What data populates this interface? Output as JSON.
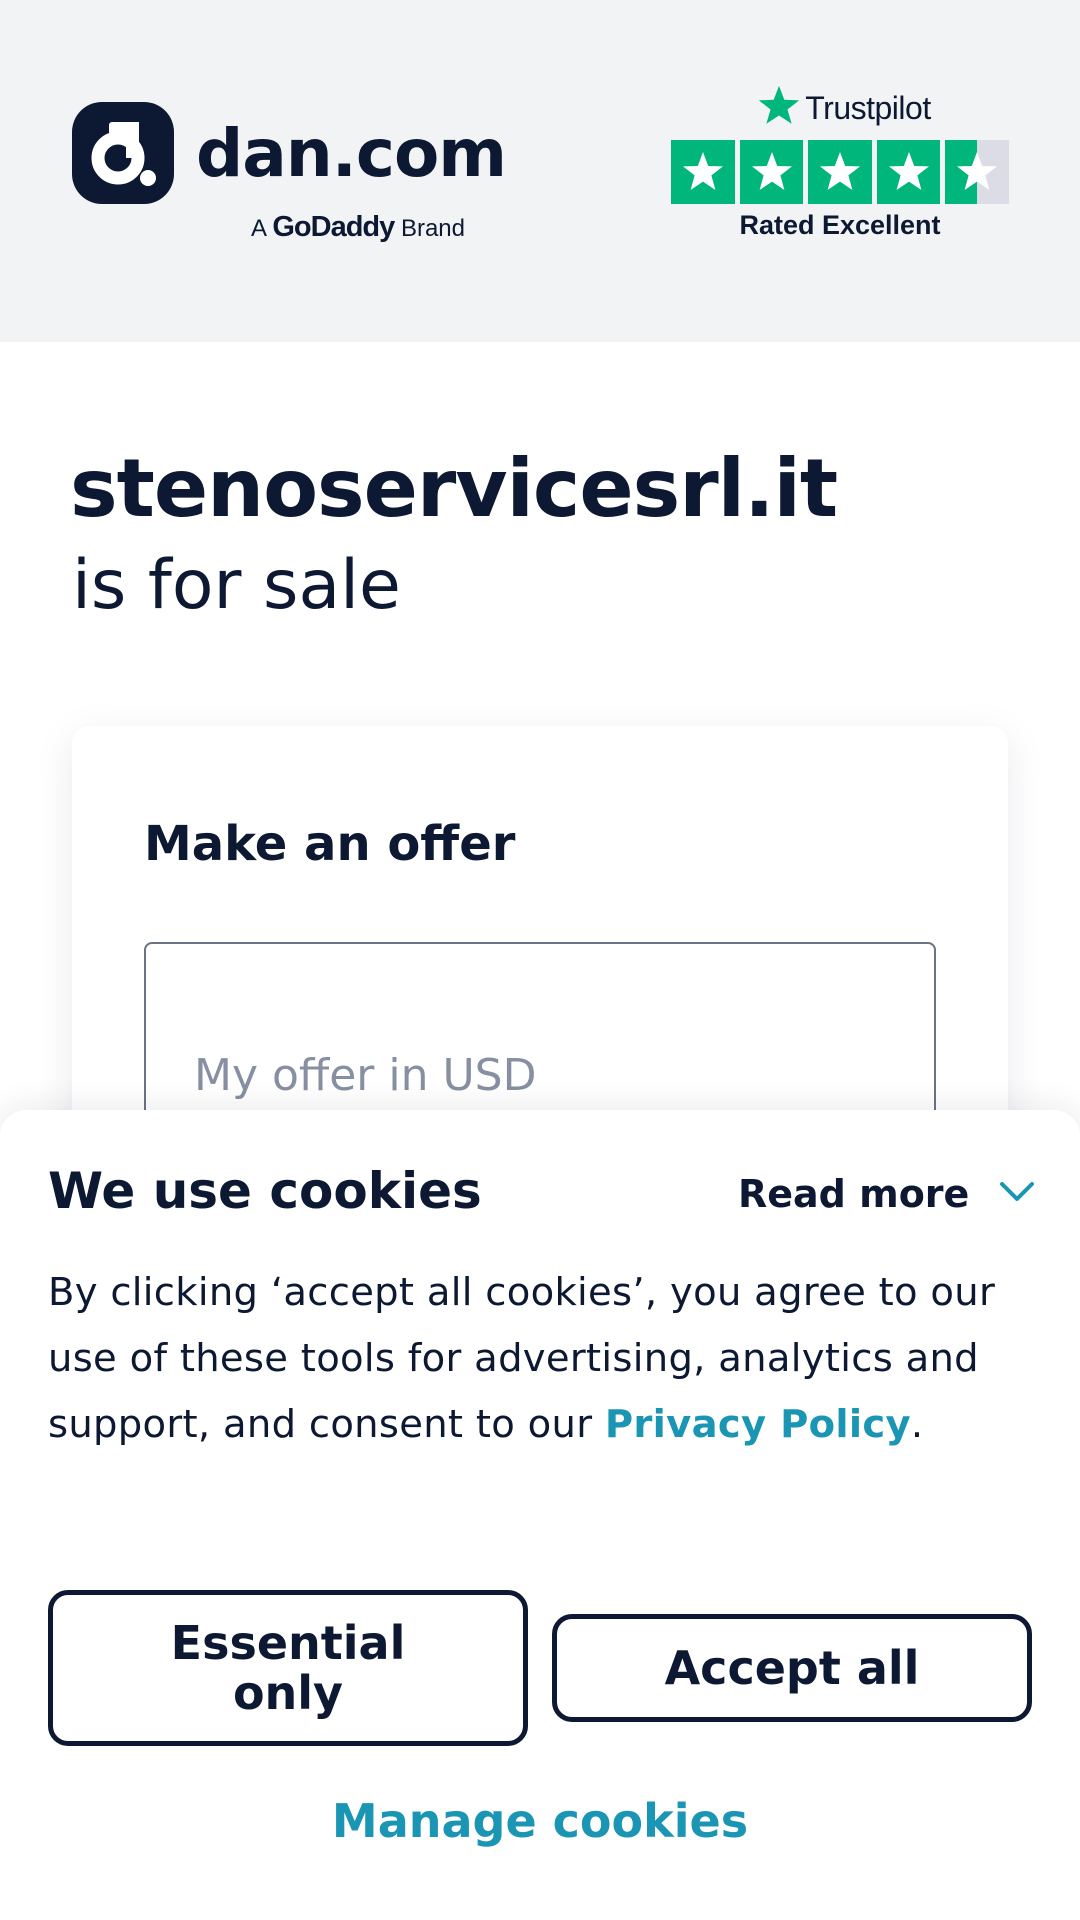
{
  "header": {
    "logo": {
      "wordmark": "dan.com",
      "brand_prefix": "A",
      "brand_name": "GoDaddy",
      "brand_suffix": "Brand",
      "icon": "dan-logo-icon"
    },
    "trustpilot": {
      "name": "Trustpilot",
      "rating_text": "Rated Excellent",
      "stars": 4.5,
      "star_color": "#00b67a"
    }
  },
  "main": {
    "domain": "stenoservicesrl.it",
    "subtitle": "is for sale",
    "offer": {
      "title": "Make an offer",
      "input_placeholder": "My offer in USD",
      "input_value": ""
    }
  },
  "cookie_banner": {
    "title": "We use cookies",
    "read_more": "Read more",
    "text_before_link": "By clicking ‘accept all cookies’, you agree to our use of these tools for advertising, analytics and support, and consent to our ",
    "link_text": "Privacy Policy",
    "text_after_link": ".",
    "essential_button": "Essential only",
    "accept_button": "Accept all",
    "manage_link": "Manage cookies",
    "link_color": "#1a95b3"
  },
  "colors": {
    "navy": "#0d1933",
    "header_bg": "#f2f3f5"
  }
}
